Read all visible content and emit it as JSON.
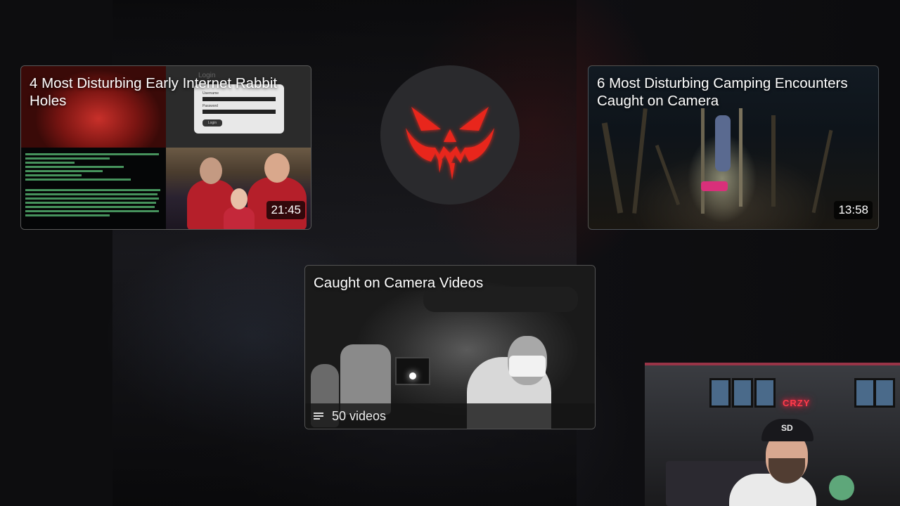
{
  "end_screen": {
    "videos": [
      {
        "title": "4 Most Disturbing Early Internet Rabbit Holes",
        "duration": "21:45"
      },
      {
        "title": "6 Most Disturbing Camping Encounters Caught on Camera",
        "duration": "13:58"
      }
    ],
    "playlist": {
      "title": "Caught on Camera Videos",
      "count_label": "50 videos"
    },
    "channel_logo": {
      "icon": "jack-o-lantern-icon",
      "color": "#e8281e"
    },
    "thumbnail_text": {
      "login_title": "Login",
      "username_label": "Username",
      "password_label": "Password",
      "login_button": "Login"
    },
    "webcam": {
      "sign_text": "CRZY",
      "cap_logo": "SD"
    }
  }
}
